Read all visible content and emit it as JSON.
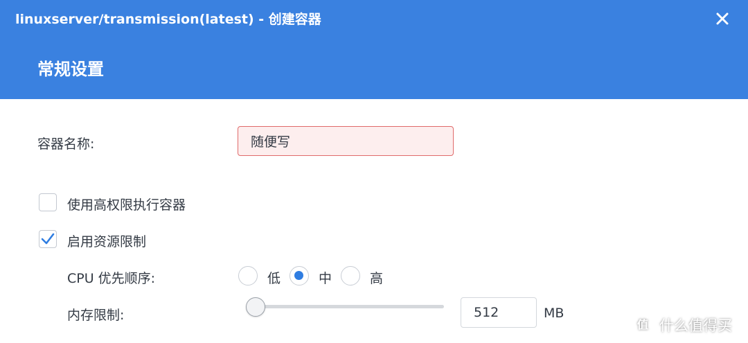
{
  "window": {
    "title": "linuxserver/transmission(latest) - 创建容器",
    "close_icon": "close-icon"
  },
  "section": {
    "title": "常规设置"
  },
  "form": {
    "container_name": {
      "label": "容器名称:",
      "value": "随便写"
    },
    "privileged": {
      "label": "使用高权限执行容器",
      "checked": false
    },
    "resource_limit": {
      "label": "启用资源限制",
      "checked": true
    },
    "cpu_priority": {
      "label": "CPU 优先顺序:",
      "options": [
        "低",
        "中",
        "高"
      ],
      "selected": "中"
    },
    "memory_limit": {
      "label": "内存限制:",
      "value": "512",
      "unit": "MB",
      "slider_fraction": 0
    }
  },
  "watermark": {
    "text": "什么值得买",
    "icon": "smzdm-logo-icon"
  },
  "colors": {
    "header_bg": "#3a81e0",
    "accent": "#2f7de1",
    "error_border": "#e06a6a",
    "error_bg": "#fdeeee"
  }
}
